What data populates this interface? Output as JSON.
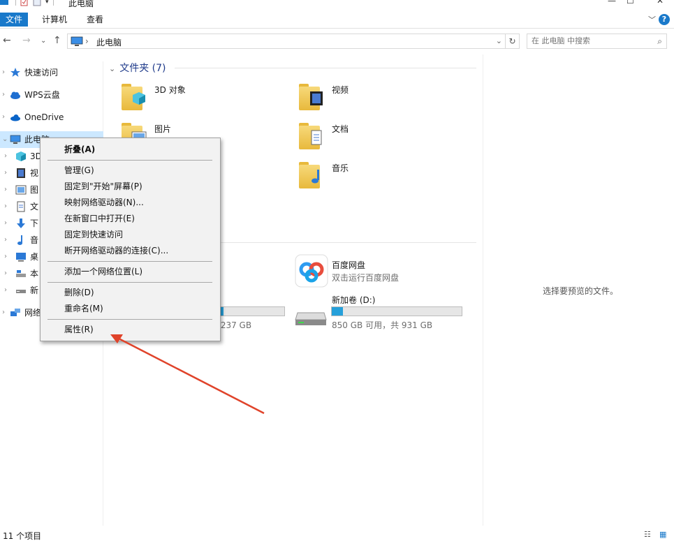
{
  "window": {
    "title": "此电脑"
  },
  "ribbon": {
    "tabs": [
      "文件",
      "计算机",
      "查看"
    ]
  },
  "address": {
    "path": "此电脑"
  },
  "search": {
    "placeholder": "在 此电脑 中搜索"
  },
  "nav": {
    "items": [
      {
        "label": "快速访问",
        "icon": "star-icon"
      },
      {
        "label": "WPS云盘",
        "icon": "cloud-icon"
      },
      {
        "label": "OneDrive",
        "icon": "onedrive-icon"
      },
      {
        "label": "此电脑",
        "icon": "computer-icon"
      },
      {
        "label": "3D",
        "icon": "3d-objects-icon"
      },
      {
        "label": "视",
        "icon": "video-icon"
      },
      {
        "label": "图",
        "icon": "pictures-icon"
      },
      {
        "label": "文",
        "icon": "documents-icon"
      },
      {
        "label": "下",
        "icon": "download-icon"
      },
      {
        "label": "音",
        "icon": "music-icon"
      },
      {
        "label": "桌",
        "icon": "desktop-icon"
      },
      {
        "label": "本",
        "icon": "local-disk-icon"
      },
      {
        "label": "新",
        "icon": "drive-icon"
      },
      {
        "label": "网络",
        "icon": "network-icon"
      }
    ]
  },
  "main": {
    "folders_header": "文件夹 (7)",
    "folders": [
      {
        "label": "3D 对象",
        "icon": "3d-objects-folder-icon"
      },
      {
        "label": "视频",
        "icon": "video-folder-icon"
      },
      {
        "label": "图片",
        "icon": "pictures-folder-icon"
      },
      {
        "label": "文档",
        "icon": "documents-folder-icon"
      },
      {
        "label": "音乐",
        "icon": "music-folder-icon"
      }
    ],
    "devices": [
      {
        "name": "百度网盘",
        "info": "双击运行百度网盘",
        "icon": "baidu-netdisk-icon"
      },
      {
        "name": "新加卷 (D:)",
        "info": "850 GB 可用，共 931 GB",
        "usage": 0.087,
        "icon": "hard-drive-icon"
      }
    ],
    "c_drive": {
      "info": "共 237 GB",
      "usage": 0.53
    }
  },
  "preview": {
    "text": "选择要预览的文件。"
  },
  "status": {
    "count": "11 个项目"
  },
  "context_menu": {
    "items": [
      "折叠(A)",
      "管理(G)",
      "固定到\"开始\"屏幕(P)",
      "映射网络驱动器(N)...",
      "在新窗口中打开(E)",
      "固定到快速访问",
      "断开网络驱动器的连接(C)...",
      "添加一个网络位置(L)",
      "删除(D)",
      "重命名(M)",
      "属性(R)"
    ]
  },
  "colors": {
    "accent": "#1979ca",
    "selection": "#cce8ff",
    "drive_fill": "#26a0da",
    "arrow": "#e0432a"
  }
}
